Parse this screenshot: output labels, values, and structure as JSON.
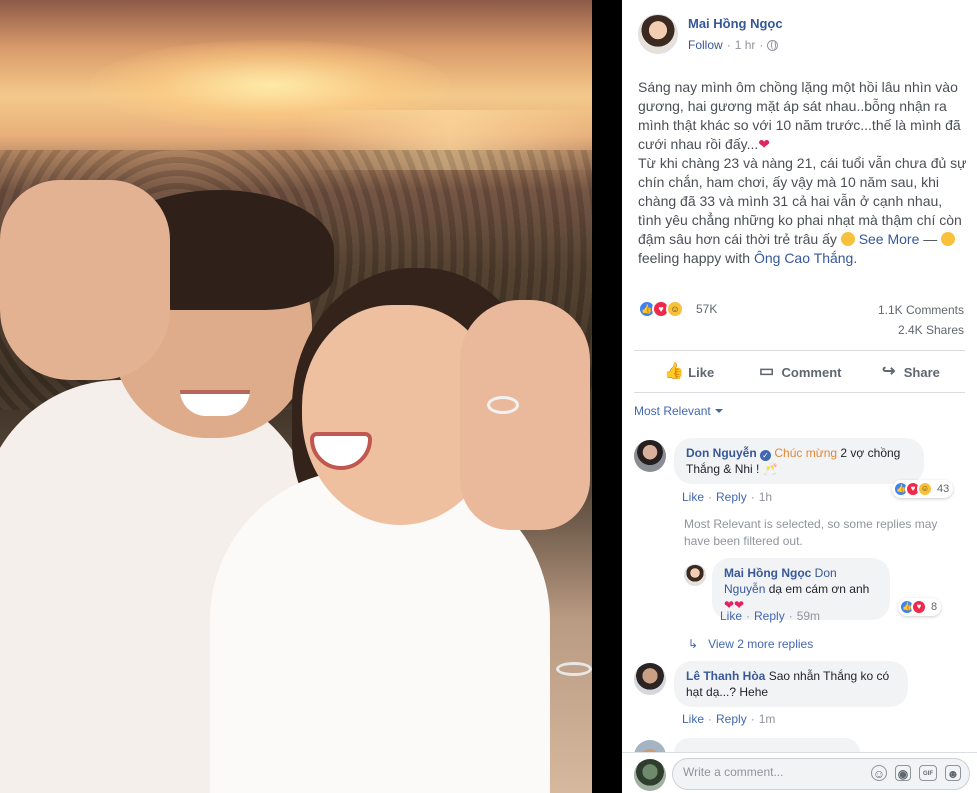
{
  "post": {
    "author": "Mai Hồng Ngọc",
    "follow": "Follow",
    "separator": "·",
    "time": "1 hr",
    "body": {
      "para1": "Sáng nay mình ôm chồng lặng một hồi lâu nhìn vào gương, hai gương mặt áp sát nhau..bỗng nhận ra mình thật khác so với 10 năm trước...thế là mình đã cưới nhau rồi đấy...",
      "heart": "❤",
      "para2": "Từ khi chàng 23 và nàng 21, cái tuổi vẫn chưa đủ sự chín chắn, ham chơi, ấy vậy mà 10 năm sau, khi chàng đã 33 và mình 31 cả hai vẫn ở cạnh nhau, tình yêu chẳng những ko phai nhạt mà thậm chí còn đậm sâu hơn cái thời trẻ trâu ấy",
      "see_more": "See More",
      "feeling_dash": " — ",
      "feeling_prefix": "feeling happy with ",
      "tagged": "Ông Cao Thắng",
      "period": "."
    }
  },
  "stats": {
    "reactions": "57K",
    "comments": "1.1K Comments",
    "shares": "2.4K Shares"
  },
  "actions": {
    "like": "Like",
    "comment": "Comment",
    "share": "Share"
  },
  "sort": {
    "label": "Most Relevant"
  },
  "comments": [
    {
      "name": "Don Nguyễn",
      "highlight": "Chúc mừng",
      "text": " 2 vợ chồng Thắng & Nhi ! 🥂",
      "like": "Like",
      "reply": "Reply",
      "time": "1h",
      "reactions": "43"
    },
    {
      "name": "Lê Thanh Hòa",
      "text": "Sao nhẫn Thắng ko có hạt dạ...? Hehe",
      "like": "Like",
      "reply": "Reply",
      "time": "1m"
    }
  ],
  "filter_note": "Most Relevant is selected, so some replies may have been filtered out.",
  "reply": {
    "name": "Mai Hồng Ngọc",
    "tag": "Don Nguyễn",
    "text": " dạ em cám ơn anh ",
    "hearts": "❤❤",
    "like": "Like",
    "reply": "Reply",
    "time": "59m",
    "reactions": "8"
  },
  "view_replies": "View 2 more replies",
  "composer": {
    "placeholder": "Write a comment..."
  },
  "icons": {
    "globe": "globe-icon",
    "like": "thumbs-up-icon",
    "comment": "speech-bubble-icon",
    "share": "share-arrow-icon"
  },
  "colors": {
    "link": "#365899",
    "accent": "#4267b2",
    "love": "#e0245e",
    "muted": "#90949c"
  }
}
